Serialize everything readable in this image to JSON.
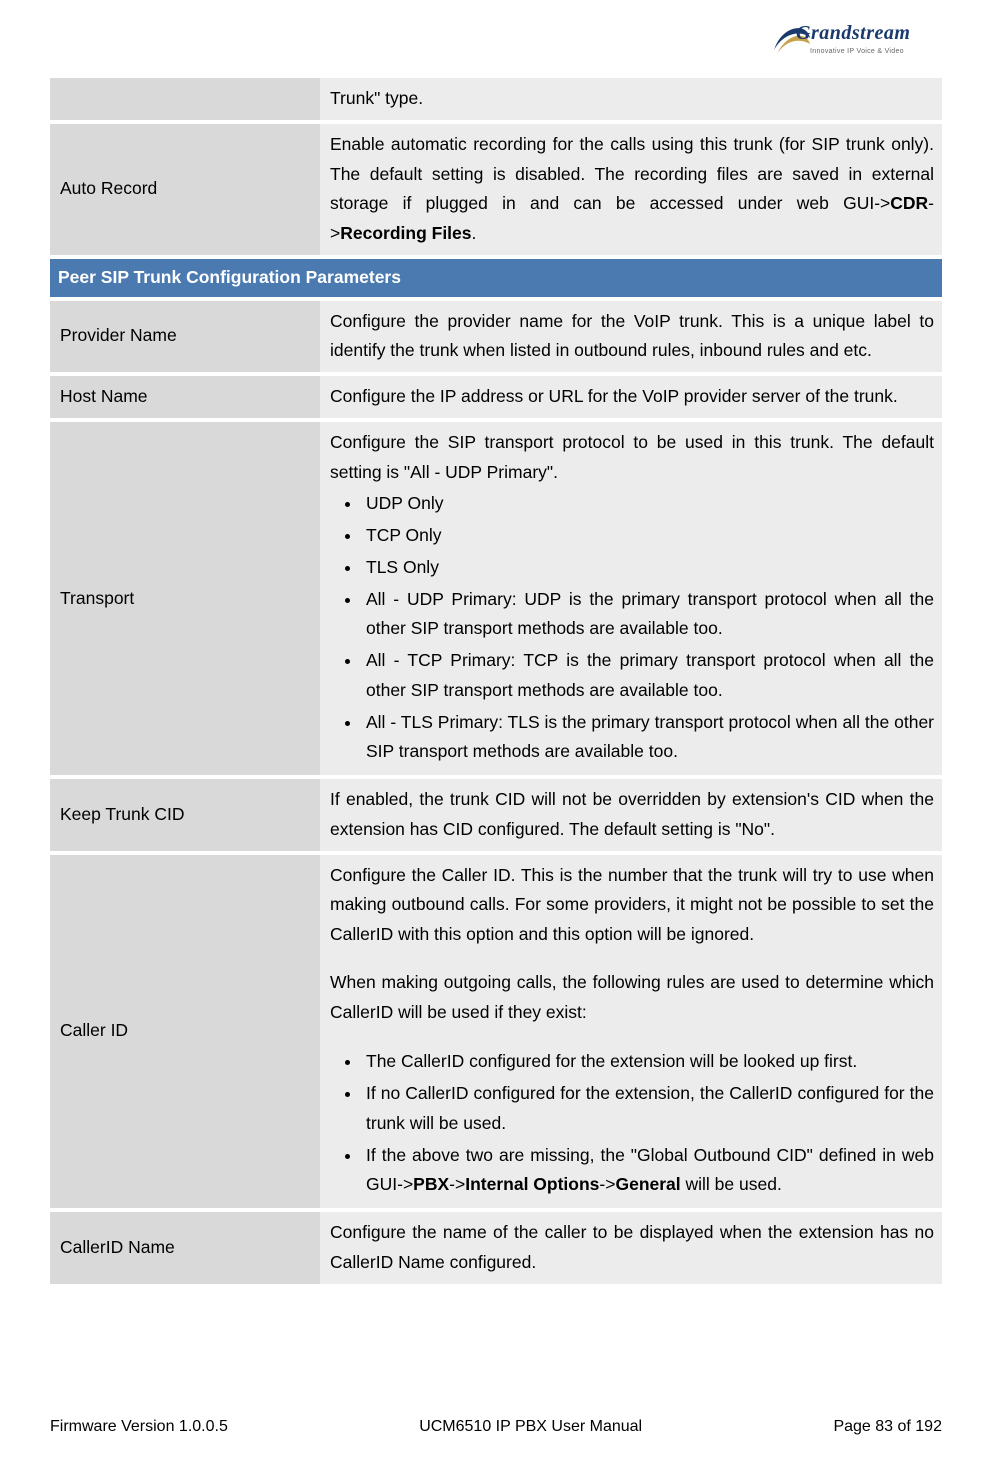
{
  "logo": {
    "brand": "Grandstream",
    "tagline": "Innovative IP Voice & Video"
  },
  "rows": {
    "trunkTypeFragment": "Trunk\" type.",
    "autoRecord": {
      "label": "Auto Record",
      "para1a": "Enable automatic recording for the calls using this trunk (for SIP trunk only). The default setting is disabled. The recording files are saved in external storage if plugged in and can be accessed under web GUI->",
      "b1": "CDR",
      "para1b": "->",
      "b2": "Recording Files",
      "para1c": "."
    },
    "sectionHeader": "Peer SIP Trunk Configuration Parameters",
    "providerName": {
      "label": "Provider Name",
      "desc": "Configure the provider name for the VoIP trunk. This is a unique label to identify the trunk when listed in outbound rules, inbound rules and etc."
    },
    "hostName": {
      "label": "Host Name",
      "desc": "Configure the IP address or URL for the VoIP provider server of the trunk."
    },
    "transport": {
      "label": "Transport",
      "intro": "Configure the SIP transport protocol to be used in this trunk. The default setting is \"All - UDP Primary\".",
      "b1": "UDP Only",
      "b2": "TCP Only",
      "b3": "TLS Only",
      "b4": "All - UDP Primary: UDP is the primary transport protocol when all the other SIP transport methods are available too.",
      "b5": "All - TCP Primary: TCP is the primary transport protocol when all the other SIP transport methods are available too.",
      "b6": "All - TLS Primary: TLS is the primary transport protocol when all the other SIP transport methods are available too."
    },
    "keepTrunkCID": {
      "label": "Keep Trunk CID",
      "desc": "If enabled, the trunk CID will not be overridden by extension's CID when the extension has CID configured. The default setting is \"No\"."
    },
    "callerID": {
      "label": "Caller ID",
      "p1": "Configure the Caller ID. This is the number that the trunk will try to use when making outbound calls. For some providers, it might not be possible to set the CallerID with this option and this option will be ignored.",
      "p2": "When making outgoing calls, the following rules are used to determine which CallerID will be used if they exist:",
      "li1": "The CallerID configured for the extension will be looked up first.",
      "li2": "If no CallerID configured for the extension, the CallerID configured for the trunk will be used.",
      "li3a": "If the above two are missing, the \"Global Outbound CID\" defined in web GUI->",
      "li3b1": "PBX",
      "li3m1": "->",
      "li3b2": "Internal Options",
      "li3m2": "->",
      "li3b3": "General",
      "li3c": " will be used."
    },
    "callerIDName": {
      "label": "CallerID Name",
      "desc": "Configure the name of the caller to be displayed when the extension has no CallerID Name configured."
    }
  },
  "footer": {
    "left": "Firmware Version 1.0.0.5",
    "center": "UCM6510 IP PBX User Manual",
    "right": "Page 83 of 192"
  }
}
